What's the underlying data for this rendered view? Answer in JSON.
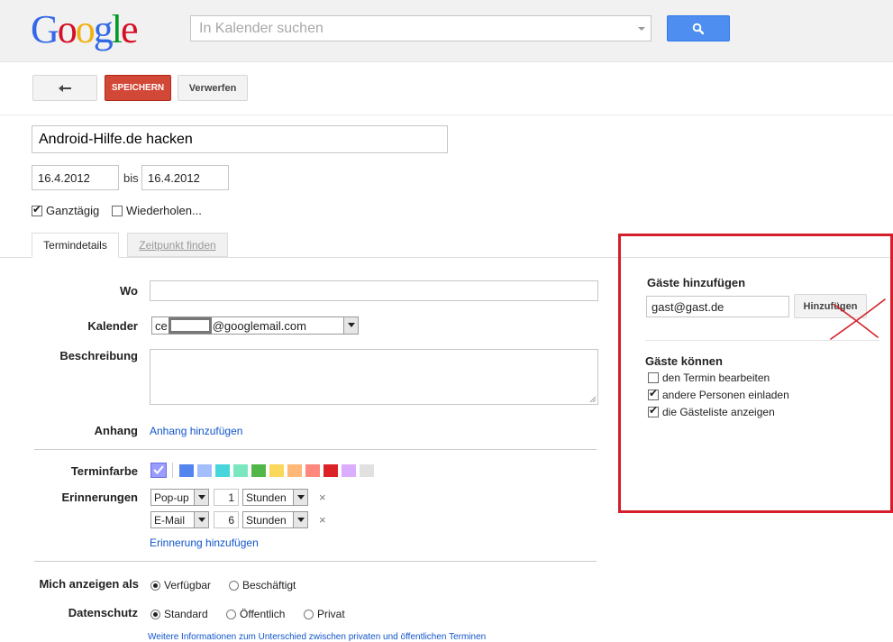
{
  "header": {
    "logo": {
      "letters": [
        "G",
        "o",
        "o",
        "g",
        "l",
        "e"
      ],
      "colors": [
        "#3369e8",
        "#d50f25",
        "#eeb211",
        "#3369e8",
        "#009925",
        "#d50f25"
      ]
    },
    "search_placeholder": "In Kalender suchen",
    "search_button_color": "#4d8ef0"
  },
  "toolbar": {
    "save_label": "SPEICHERN",
    "discard_label": "Verwerfen",
    "save_color": "#d14836"
  },
  "event": {
    "title": "Android-Hilfe.de hacken",
    "start_date": "16.4.2012",
    "to_label": "bis",
    "end_date": "16.4.2012",
    "all_day_label": "Ganztägig",
    "repeat_label": "Wiederholen..."
  },
  "tabs": [
    {
      "label": "Termindetails",
      "active": true
    },
    {
      "label": "Zeitpunkt finden",
      "active": false
    }
  ],
  "details": {
    "where_label": "Wo",
    "calendar_label": "Kalender",
    "calendar_value_prefix": "ce",
    "calendar_value_suffix": "@googlemail.com",
    "description_label": "Beschreibung",
    "attachment_label": "Anhang",
    "attachment_link": "Anhang hinzufügen",
    "color_label": "Terminfarbe",
    "colors": [
      "#5484ed",
      "#a4bdfc",
      "#46d6db",
      "#7ae7bf",
      "#51b749",
      "#fbd75b",
      "#ffb878",
      "#ff887c",
      "#dc2127",
      "#dbadff",
      "#e1e1e1"
    ],
    "selected_color": "#9a9cff",
    "reminders_label": "Erinnerungen",
    "reminders": [
      {
        "method": "Pop-up",
        "value": "1",
        "unit": "Stunden"
      },
      {
        "method": "E-Mail",
        "value": "6",
        "unit": "Stunden"
      }
    ],
    "remove_symbol": "×",
    "add_reminder_link": "Erinnerung hinzufügen",
    "show_as_label": "Mich anzeigen als",
    "show_as_options": [
      "Verfügbar",
      "Beschäftigt"
    ],
    "privacy_label": "Datenschutz",
    "privacy_options": [
      "Standard",
      "Öffentlich",
      "Privat"
    ],
    "privacy_info_link": "Weitere Informationen zum Unterschied zwischen privaten und öffentlichen Terminen"
  },
  "guests": {
    "add_title": "Gäste hinzufügen",
    "input_value": "gast@gast.de",
    "add_button": "Hinzufügen",
    "can_title": "Gäste können",
    "permissions": [
      {
        "label": "den Termin bearbeiten",
        "checked": false
      },
      {
        "label": "andere Personen einladen",
        "checked": true
      },
      {
        "label": "die Gästeliste anzeigen",
        "checked": true
      }
    ],
    "highlight_color": "#d41f2a"
  }
}
